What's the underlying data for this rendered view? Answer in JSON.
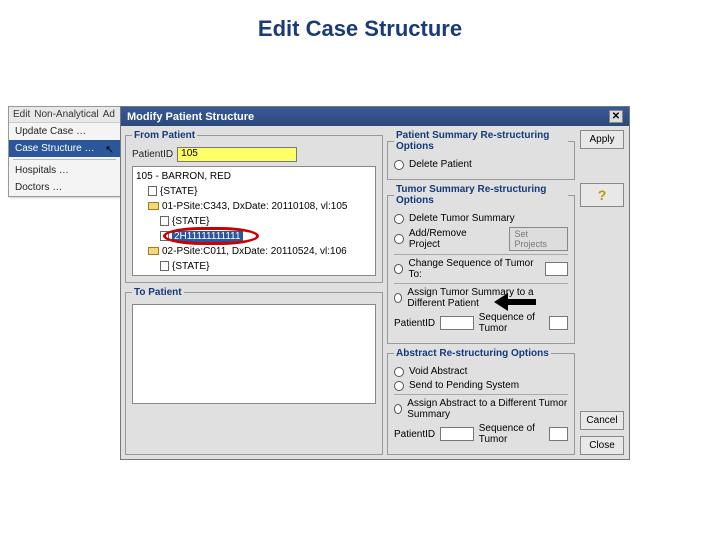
{
  "page_title": "Edit Case Structure",
  "edit_menu": {
    "bar": [
      "Edit",
      "Non-Analytical",
      "Ad"
    ],
    "items": [
      "Update Case …",
      "Case Structure …",
      "Hospitals …",
      "Doctors …"
    ],
    "selected_index": 1
  },
  "dialog": {
    "title": "Modify Patient Structure",
    "close": "✕",
    "from_patient": {
      "legend": "From Patient",
      "patient_id_label": "PatientID",
      "patient_id_value": "105",
      "tree": {
        "root": "105 - BARRON, RED",
        "state1": "{STATE}",
        "item1": "01-PSite:C343, DxDate: 20110108, vl:105",
        "state2": "{STATE}",
        "highlight": "2H11111111111",
        "item2": "02-PSite:C011, DxDate: 20110524, vl:106",
        "state3": "{STATE}"
      }
    },
    "to_patient": {
      "legend": "To Patient"
    },
    "patient_opts": {
      "legend": "Patient Summary Re-structuring Options",
      "delete_patient": "Delete Patient"
    },
    "tumor_opts": {
      "legend": "Tumor Summary Re-structuring Options",
      "delete_tumor": "Delete Tumor Summary",
      "add_remove_project": "Add/Remove Project",
      "set_projects_btn": "Set Projects",
      "change_seq": "Change Sequence of Tumor To:",
      "assign_tumor": "Assign Tumor Summary to a Different Patient",
      "patient_id_label": "PatientID",
      "seq_label": "Sequence of Tumor"
    },
    "abstract_opts": {
      "legend": "Abstract Re-structuring Options",
      "void_abstract": "Void Abstract",
      "send_pending": "Send to Pending System",
      "assign_abstract": "Assign Abstract to a Different Tumor Summary",
      "patient_id_label": "PatientID",
      "seq_label": "Sequence of Tumor"
    },
    "buttons": {
      "apply": "Apply",
      "help": "?",
      "cancel": "Cancel",
      "close": "Close"
    }
  }
}
